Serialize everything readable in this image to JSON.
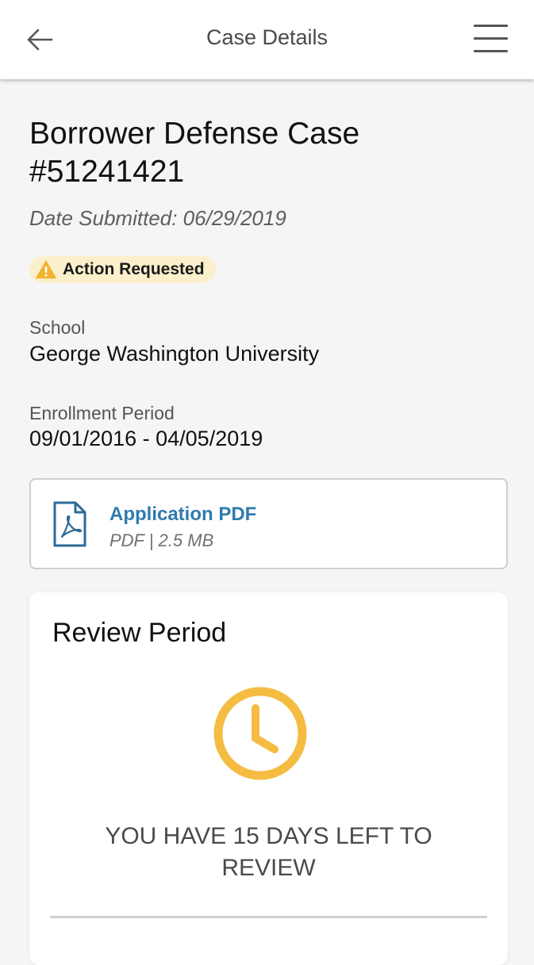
{
  "header": {
    "title": "Case Details",
    "back_icon": "arrow-left-icon",
    "menu_icon": "hamburger-menu-icon"
  },
  "case": {
    "title": "Borrower Defense Case #51241421",
    "date_submitted": "Date Submitted: 06/29/2019",
    "status": {
      "label": "Action Requested",
      "icon": "warning-icon",
      "color": "#fbf0cb",
      "icon_color": "#f2b330"
    },
    "school": {
      "label": "School",
      "value": "George Washington University"
    },
    "enrollment": {
      "label": "Enrollment Period",
      "value": "09/01/2016 - 04/05/2019"
    }
  },
  "document": {
    "name": "Application PDF",
    "meta": "PDF | 2.5 MB",
    "icon": "pdf-file-icon",
    "link_color": "#2e7bae"
  },
  "review": {
    "title": "Review Period",
    "icon": "clock-icon",
    "icon_color": "#f5bc42",
    "message": "YOU HAVE 15 DAYS LEFT TO REVIEW"
  }
}
